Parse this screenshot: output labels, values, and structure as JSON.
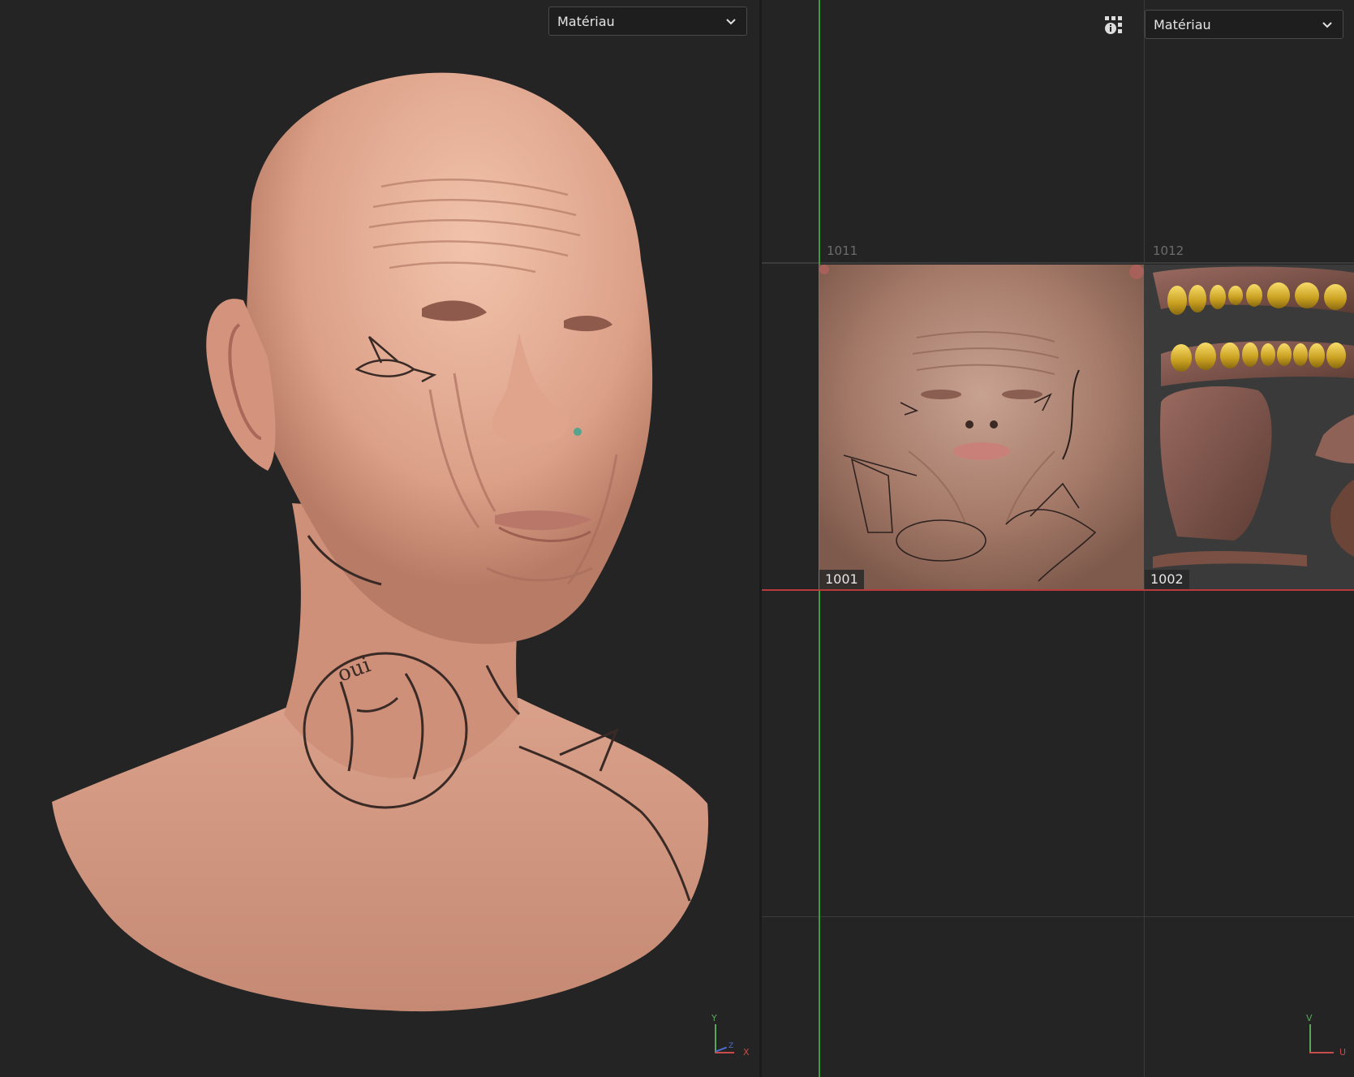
{
  "viewport_3d": {
    "material_dropdown": "Matériau",
    "axis_y": "Y",
    "axis_x": "X",
    "axis_z": "Z"
  },
  "viewport_uv": {
    "material_dropdown": "Matériau",
    "tiles": [
      {
        "id": "1011",
        "label": ""
      },
      {
        "id": "1012",
        "label": ""
      },
      {
        "id": "1001",
        "label": "1001"
      },
      {
        "id": "1002",
        "label": "1002"
      }
    ],
    "axis_v": "V",
    "axis_u": "U",
    "display_icon": "grid-info-icon"
  },
  "colors": {
    "background": "#242424",
    "v_axis_line": "#3e9b3e",
    "u_axis_line": "#b83a3a",
    "skin": "#d99a82"
  }
}
